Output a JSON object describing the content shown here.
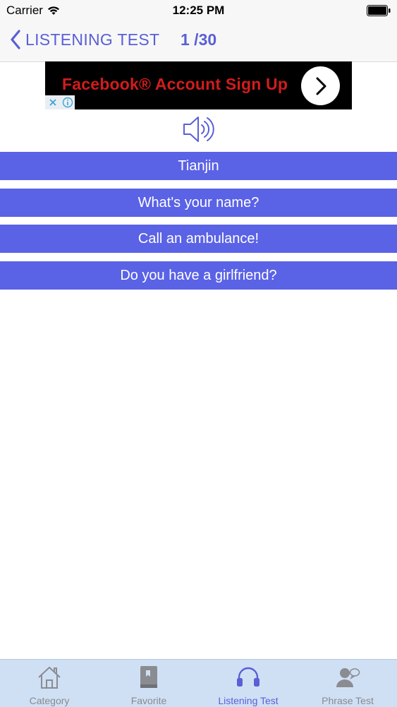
{
  "status_bar": {
    "carrier": "Carrier",
    "time": "12:25 PM"
  },
  "nav": {
    "back_label": "LISTENING TEST",
    "progress": "1 /30"
  },
  "ad": {
    "text": "Facebook® Account Sign Up",
    "background": "#000000",
    "text_color": "#d21c1c"
  },
  "speaker_icon": "speaker-icon",
  "options": [
    "Tianjin",
    "What's your name?",
    "Call an ambulance!",
    "Do you have a girlfriend?"
  ],
  "tabs": [
    {
      "label": "Category",
      "icon": "house-icon",
      "active": false
    },
    {
      "label": "Favorite",
      "icon": "book-icon",
      "active": false
    },
    {
      "label": "Listening Test",
      "icon": "headphones-icon",
      "active": true
    },
    {
      "label": "Phrase Test",
      "icon": "person-chat-icon",
      "active": false
    }
  ],
  "colors": {
    "accent": "#5a5fd6",
    "option_background": "#5a62e6",
    "tab_bar_background": "#cfe0f5",
    "tab_inactive": "#888a8f"
  }
}
